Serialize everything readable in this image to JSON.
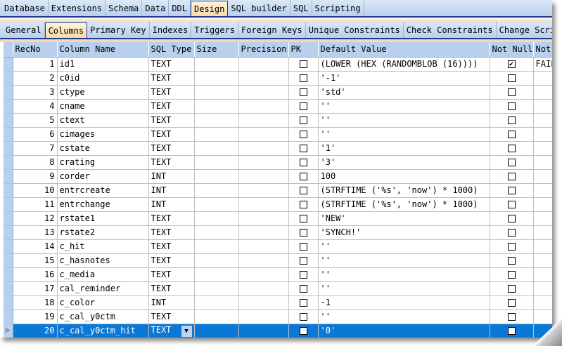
{
  "main_tabs": [
    "Database",
    "Extensions",
    "Schema",
    "Data",
    "DDL",
    "Design",
    "SQL builder",
    "SQL",
    "Scripting"
  ],
  "main_tabs_active": "Design",
  "sub_tabs": [
    "General",
    "Columns",
    "Primary Key",
    "Indexes",
    "Triggers",
    "Foreign Keys",
    "Unique Constraints",
    "Check Constraints",
    "Change Script"
  ],
  "sub_tabs_active": "Columns",
  "columns": [
    "RecNo",
    "Column Name",
    "SQL Type",
    "Size",
    "Precision",
    "PK",
    "Default Value",
    "Not Null",
    "Not Null On Conflict"
  ],
  "rows": [
    {
      "rec": "1",
      "name": "id1",
      "type": "TEXT",
      "size": "",
      "precision": "",
      "pk": false,
      "default": "(LOWER (HEX (RANDOMBLOB (16))))",
      "notnull": true,
      "conflict": "FAIL"
    },
    {
      "rec": "2",
      "name": "c0id",
      "type": "TEXT",
      "size": "",
      "precision": "",
      "pk": false,
      "default": "'-1'",
      "notnull": false,
      "conflict": ""
    },
    {
      "rec": "3",
      "name": "ctype",
      "type": "TEXT",
      "size": "",
      "precision": "",
      "pk": false,
      "default": "'std'",
      "notnull": false,
      "conflict": ""
    },
    {
      "rec": "4",
      "name": "cname",
      "type": "TEXT",
      "size": "",
      "precision": "",
      "pk": false,
      "default": "''",
      "notnull": false,
      "conflict": ""
    },
    {
      "rec": "5",
      "name": "ctext",
      "type": "TEXT",
      "size": "",
      "precision": "",
      "pk": false,
      "default": "''",
      "notnull": false,
      "conflict": ""
    },
    {
      "rec": "6",
      "name": "cimages",
      "type": "TEXT",
      "size": "",
      "precision": "",
      "pk": false,
      "default": "''",
      "notnull": false,
      "conflict": ""
    },
    {
      "rec": "7",
      "name": "cstate",
      "type": "TEXT",
      "size": "",
      "precision": "",
      "pk": false,
      "default": "'1'",
      "notnull": false,
      "conflict": ""
    },
    {
      "rec": "8",
      "name": "crating",
      "type": "TEXT",
      "size": "",
      "precision": "",
      "pk": false,
      "default": "'3'",
      "notnull": false,
      "conflict": ""
    },
    {
      "rec": "9",
      "name": "corder",
      "type": "INT",
      "size": "",
      "precision": "",
      "pk": false,
      "default": "100",
      "notnull": false,
      "conflict": ""
    },
    {
      "rec": "10",
      "name": "entrcreate",
      "type": "INT",
      "size": "",
      "precision": "",
      "pk": false,
      "default": "(STRFTIME ('%s', 'now') * 1000)",
      "notnull": false,
      "conflict": ""
    },
    {
      "rec": "11",
      "name": "entrchange",
      "type": "INT",
      "size": "",
      "precision": "",
      "pk": false,
      "default": "(STRFTIME ('%s', 'now') * 1000)",
      "notnull": false,
      "conflict": ""
    },
    {
      "rec": "12",
      "name": "rstate1",
      "type": "TEXT",
      "size": "",
      "precision": "",
      "pk": false,
      "default": "'NEW'",
      "notnull": false,
      "conflict": ""
    },
    {
      "rec": "13",
      "name": "rstate2",
      "type": "TEXT",
      "size": "",
      "precision": "",
      "pk": false,
      "default": "'SYNCH!'",
      "notnull": false,
      "conflict": ""
    },
    {
      "rec": "14",
      "name": "c_hit",
      "type": "TEXT",
      "size": "",
      "precision": "",
      "pk": false,
      "default": "''",
      "notnull": false,
      "conflict": ""
    },
    {
      "rec": "15",
      "name": "c_hasnotes",
      "type": "TEXT",
      "size": "",
      "precision": "",
      "pk": false,
      "default": "''",
      "notnull": false,
      "conflict": ""
    },
    {
      "rec": "16",
      "name": "c_media",
      "type": "TEXT",
      "size": "",
      "precision": "",
      "pk": false,
      "default": "''",
      "notnull": false,
      "conflict": ""
    },
    {
      "rec": "17",
      "name": "cal_reminder",
      "type": "TEXT",
      "size": "",
      "precision": "",
      "pk": false,
      "default": "''",
      "notnull": false,
      "conflict": ""
    },
    {
      "rec": "18",
      "name": "c_color",
      "type": "INT",
      "size": "",
      "precision": "",
      "pk": false,
      "default": "-1",
      "notnull": false,
      "conflict": ""
    },
    {
      "rec": "19",
      "name": "c_cal_y0ctm",
      "type": "TEXT",
      "size": "",
      "precision": "",
      "pk": false,
      "default": "''",
      "notnull": false,
      "conflict": ""
    },
    {
      "rec": "20",
      "name": "c_cal_y0ctm_hit",
      "type": "TEXT",
      "size": "",
      "precision": "",
      "pk": false,
      "default": "'0'",
      "notnull": false,
      "conflict": ""
    }
  ],
  "selected_row": "20"
}
